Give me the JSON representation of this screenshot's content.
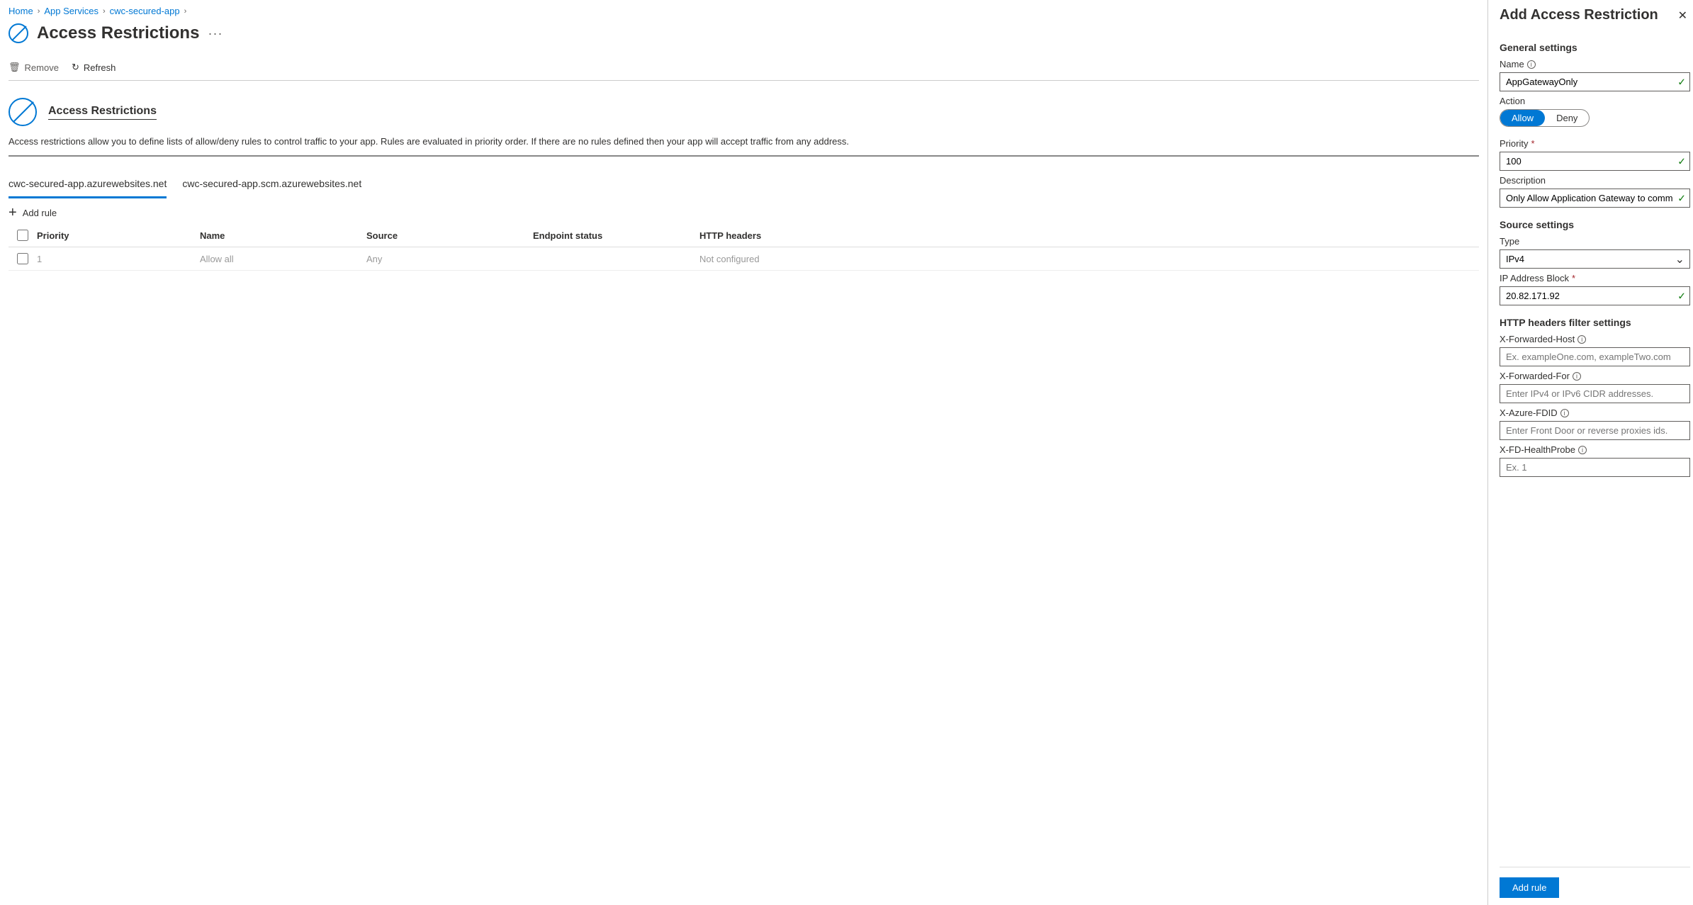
{
  "breadcrumb": {
    "home": "Home",
    "services": "App Services",
    "app": "cwc-secured-app"
  },
  "page_title": "Access Restrictions",
  "toolbar": {
    "remove": "Remove",
    "refresh": "Refresh"
  },
  "section": {
    "heading": "Access Restrictions",
    "description": "Access restrictions allow you to define lists of allow/deny rules to control traffic to your app. Rules are evaluated in priority order. If there are no rules defined then your app will accept traffic from any address."
  },
  "tabs": {
    "main": "cwc-secured-app.azurewebsites.net",
    "scm": "cwc-secured-app.scm.azurewebsites.net"
  },
  "add_rule_label": "Add rule",
  "columns": {
    "priority": "Priority",
    "name": "Name",
    "source": "Source",
    "endpoint": "Endpoint status",
    "http": "HTTP headers"
  },
  "rows": [
    {
      "priority": "1",
      "name": "Allow all",
      "source": "Any",
      "endpoint": "",
      "http": "Not configured"
    }
  ],
  "panel": {
    "title": "Add Access Restriction",
    "general_heading": "General settings",
    "name_label": "Name",
    "name_value": "AppGatewayOnly",
    "action_label": "Action",
    "action_allow": "Allow",
    "action_deny": "Deny",
    "priority_label": "Priority",
    "priority_value": "100",
    "description_label": "Description",
    "description_value": "Only Allow Application Gateway to communi...",
    "source_heading": "Source settings",
    "type_label": "Type",
    "type_value": "IPv4",
    "ip_label": "IP Address Block",
    "ip_value": "20.82.171.92",
    "http_heading": "HTTP headers filter settings",
    "xfh_label": "X-Forwarded-Host",
    "xfh_placeholder": "Ex. exampleOne.com, exampleTwo.com",
    "xff_label": "X-Forwarded-For",
    "xff_placeholder": "Enter IPv4 or IPv6 CIDR addresses.",
    "fdid_label": "X-Azure-FDID",
    "fdid_placeholder": "Enter Front Door or reverse proxies ids.",
    "hp_label": "X-FD-HealthProbe",
    "hp_placeholder": "Ex. 1",
    "submit": "Add rule"
  }
}
